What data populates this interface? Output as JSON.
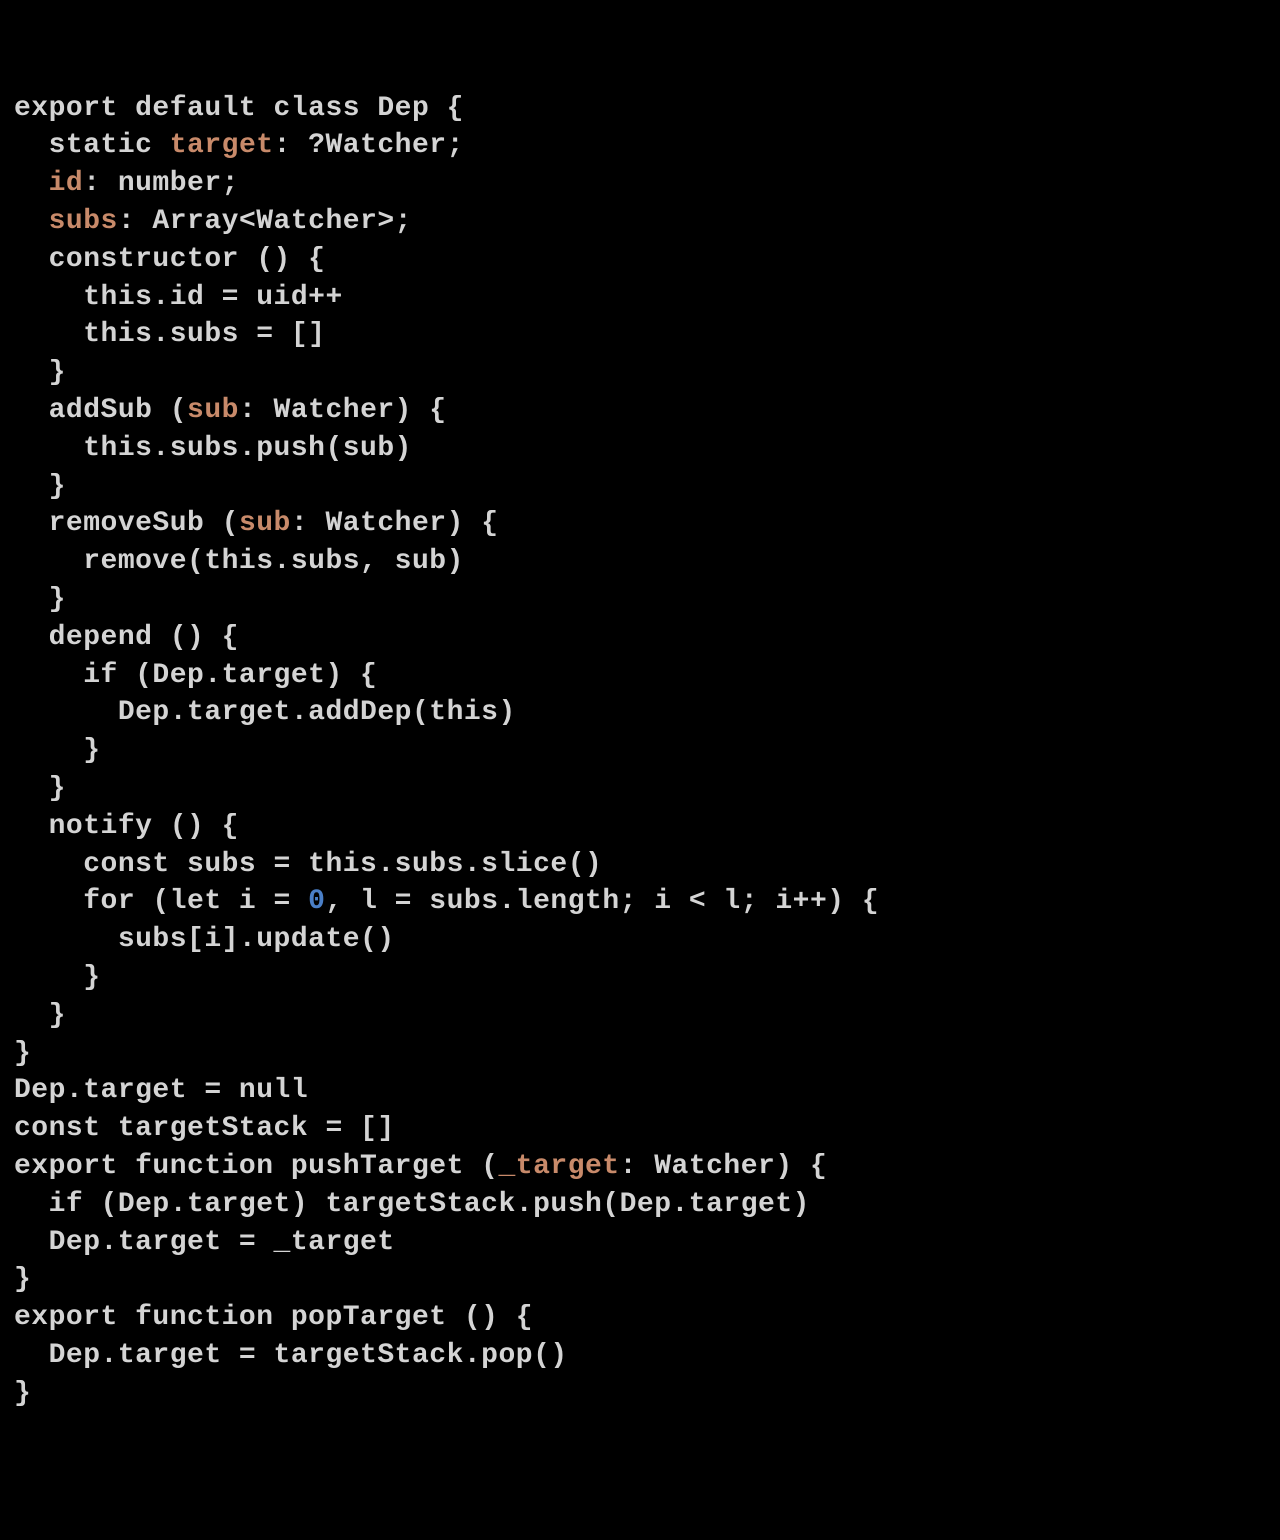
{
  "code": {
    "language": "typescript-flow",
    "theme": "dark",
    "background": "#000000",
    "colors": {
      "plain": "#d4d4d4",
      "property": "#c88a6a",
      "number": "#4a7fc7"
    },
    "lines": [
      [
        {
          "t": "export default class Dep {",
          "c": "plain"
        }
      ],
      [
        {
          "t": "  static ",
          "c": "plain"
        },
        {
          "t": "target",
          "c": "prop"
        },
        {
          "t": ": ?Watcher;",
          "c": "plain"
        }
      ],
      [
        {
          "t": "  ",
          "c": "plain"
        },
        {
          "t": "id",
          "c": "prop"
        },
        {
          "t": ": number;",
          "c": "plain"
        }
      ],
      [
        {
          "t": "  ",
          "c": "plain"
        },
        {
          "t": "subs",
          "c": "prop"
        },
        {
          "t": ": Array<Watcher>;",
          "c": "plain"
        }
      ],
      [
        {
          "t": "  constructor () {",
          "c": "plain"
        }
      ],
      [
        {
          "t": "    this.id = uid++",
          "c": "plain"
        }
      ],
      [
        {
          "t": "    this.subs = []",
          "c": "plain"
        }
      ],
      [
        {
          "t": "  }",
          "c": "plain"
        }
      ],
      [
        {
          "t": "  addSub (",
          "c": "plain"
        },
        {
          "t": "sub",
          "c": "prop"
        },
        {
          "t": ": Watcher) {",
          "c": "plain"
        }
      ],
      [
        {
          "t": "    this.subs.push(sub)",
          "c": "plain"
        }
      ],
      [
        {
          "t": "  }",
          "c": "plain"
        }
      ],
      [
        {
          "t": "  removeSub (",
          "c": "plain"
        },
        {
          "t": "sub",
          "c": "prop"
        },
        {
          "t": ": Watcher) {",
          "c": "plain"
        }
      ],
      [
        {
          "t": "    remove(this.subs, sub)",
          "c": "plain"
        }
      ],
      [
        {
          "t": "  }",
          "c": "plain"
        }
      ],
      [
        {
          "t": "  depend () {",
          "c": "plain"
        }
      ],
      [
        {
          "t": "    if (Dep.target) {",
          "c": "plain"
        }
      ],
      [
        {
          "t": "      Dep.target.addDep(this)",
          "c": "plain"
        }
      ],
      [
        {
          "t": "    }",
          "c": "plain"
        }
      ],
      [
        {
          "t": "  }",
          "c": "plain"
        }
      ],
      [
        {
          "t": "  notify () {",
          "c": "plain"
        }
      ],
      [
        {
          "t": "    const subs = this.subs.slice()",
          "c": "plain"
        }
      ],
      [
        {
          "t": "    for (let i = ",
          "c": "plain"
        },
        {
          "t": "0",
          "c": "num"
        },
        {
          "t": ", l = subs.length; i < l; i++) {",
          "c": "plain"
        }
      ],
      [
        {
          "t": "      subs[i].update()",
          "c": "plain"
        }
      ],
      [
        {
          "t": "    }",
          "c": "plain"
        }
      ],
      [
        {
          "t": "  }",
          "c": "plain"
        }
      ],
      [
        {
          "t": "}",
          "c": "plain"
        }
      ],
      [
        {
          "t": "Dep.target = null",
          "c": "plain"
        }
      ],
      [
        {
          "t": "const targetStack = []",
          "c": "plain"
        }
      ],
      [
        {
          "t": "export function pushTarget (",
          "c": "plain"
        },
        {
          "t": "_target",
          "c": "prop"
        },
        {
          "t": ": Watcher) {",
          "c": "plain"
        }
      ],
      [
        {
          "t": "  if (Dep.target) targetStack.push(Dep.target)",
          "c": "plain"
        }
      ],
      [
        {
          "t": "  Dep.target = _target",
          "c": "plain"
        }
      ],
      [
        {
          "t": "}",
          "c": "plain"
        }
      ],
      [
        {
          "t": "export function popTarget () {",
          "c": "plain"
        }
      ],
      [
        {
          "t": "  Dep.target = targetStack.pop()",
          "c": "plain"
        }
      ],
      [
        {
          "t": "}",
          "c": "plain"
        }
      ]
    ]
  }
}
